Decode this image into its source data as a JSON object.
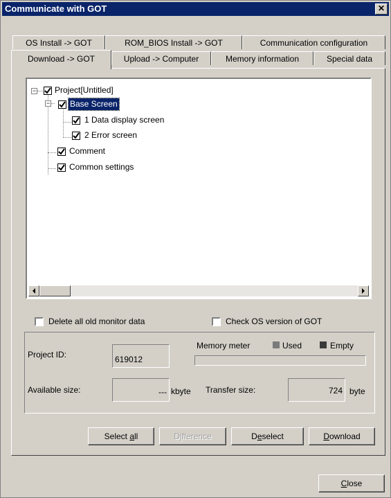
{
  "window": {
    "title": "Communicate with GOT",
    "close_glyph": "✕"
  },
  "tabs_back": [
    {
      "label": "OS Install -> GOT"
    },
    {
      "label": "ROM_BIOS Install -> GOT"
    },
    {
      "label": "Communication configuration"
    }
  ],
  "tabs_front": [
    {
      "label": "Download -> GOT",
      "active": true
    },
    {
      "label": "Upload -> Computer"
    },
    {
      "label": "Memory information"
    },
    {
      "label": "Special data"
    }
  ],
  "tree": {
    "nodes": [
      {
        "label": "Project[Untitled]",
        "checked": true
      },
      {
        "label": "Base Screen",
        "checked": true,
        "selected": true
      },
      {
        "label": "1 Data display screen",
        "checked": true
      },
      {
        "label": "2 Error screen",
        "checked": true
      },
      {
        "label": "Comment",
        "checked": true
      },
      {
        "label": "Common settings",
        "checked": true
      }
    ],
    "expander_glyph": "−"
  },
  "options": {
    "delete_old": {
      "label": "Delete all old monitor data",
      "checked": false
    },
    "check_os": {
      "label": "Check OS version of GOT",
      "checked": false
    }
  },
  "info": {
    "project_id_label": "Project ID:",
    "project_id_value": "619012",
    "memory_meter_label": "Memory meter",
    "legend_used": "Used",
    "legend_empty": "Empty",
    "used_color": "#7a7a7a",
    "empty_color": "#3a3a3a",
    "available_label": "Available size:",
    "available_value": "---",
    "available_unit": "kbyte",
    "transfer_label": "Transfer size:",
    "transfer_value": "724",
    "transfer_unit": "byte"
  },
  "buttons": {
    "select_all": {
      "pre": "Select ",
      "key": "a",
      "post": "ll"
    },
    "difference": {
      "pre": "D",
      "key": "i",
      "post": "fference"
    },
    "deselect": {
      "pre": "D",
      "key": "e",
      "post": "select"
    },
    "download": {
      "pre": "",
      "key": "D",
      "post": "ownload"
    },
    "close": {
      "pre": "",
      "key": "C",
      "post": "lose"
    }
  }
}
